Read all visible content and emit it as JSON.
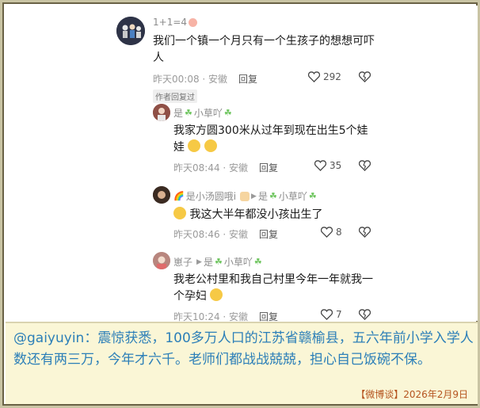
{
  "comments": [
    {
      "author": "1+1=4",
      "text": "我们一个镇一个月只有一个生孩子的想想可吓人",
      "time_loc": "昨天00:08 · 安徽",
      "reply_label": "回复",
      "likes": "292",
      "author_tag": "作者回复过"
    },
    {
      "author": "是",
      "author_suffix": "小草吖",
      "text": "我家方圆300米从过年到现在出生5个娃娃",
      "time_loc": "昨天08:44 · 安徽",
      "reply_label": "回复",
      "likes": "35"
    },
    {
      "author": "是小汤圆哦i",
      "reply_to": "是",
      "reply_to_suffix": "小草吖",
      "text": "我这大半年都没小孩出生了",
      "time_loc": "昨天08:46 · 安徽",
      "reply_label": "回复",
      "likes": "8"
    },
    {
      "author": "崽子",
      "reply_to": "是",
      "reply_to_suffix": "小草吖",
      "text": "我老公村里和我自己村里今年一年就我一个孕妇",
      "time_loc": "昨天10:24 · 安徽",
      "reply_label": "回复",
      "likes": "7"
    }
  ],
  "caption": {
    "text": "@gaiyuyin：震惊获悉，100多万人口的江苏省赣榆县，五六年前小学入学人数还有两三万，今年才六千。老师们都战战兢兢，担心自己饭碗不保。",
    "source": "【微博谈】2026年2月9日"
  },
  "icons": {
    "like": "heart-icon",
    "dislike": "broken-heart-icon",
    "reply_arrow": "triangle-right-icon",
    "clover": "four-leaf-clover-icon"
  },
  "colors": {
    "caption_text": "#2c7fb8",
    "caption_bg": "#faf6d6",
    "source_text": "#b5541f"
  }
}
